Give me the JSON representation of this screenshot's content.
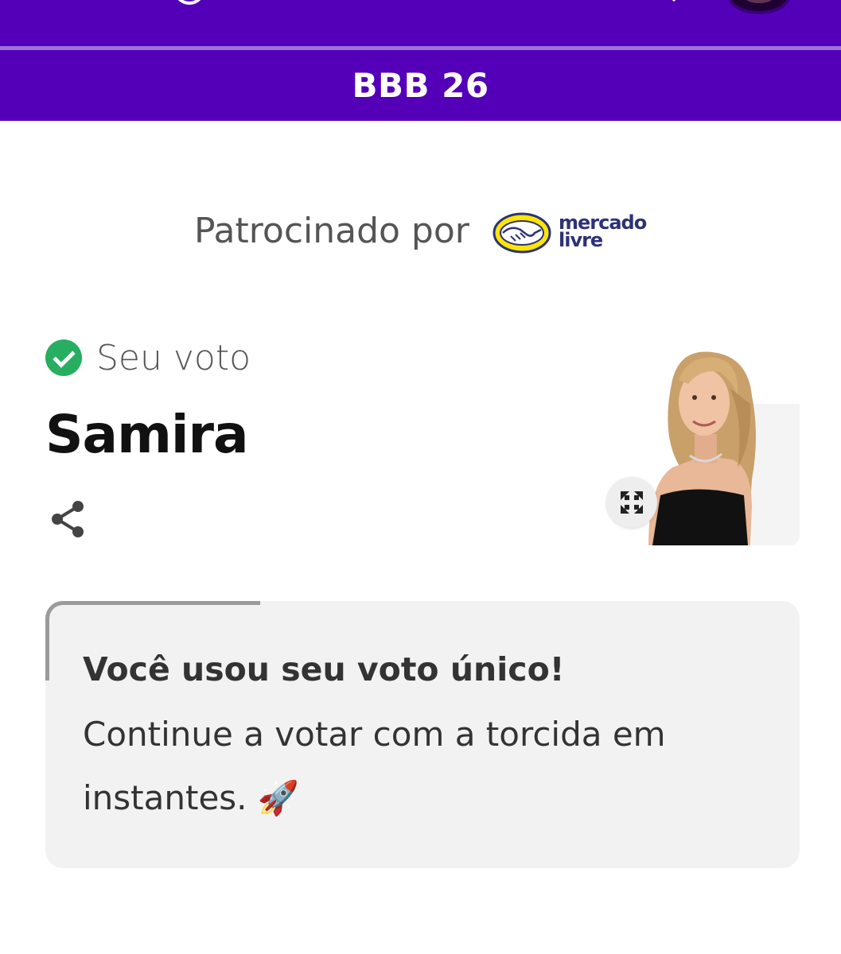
{
  "header": {
    "section_title": "BBB 26"
  },
  "sponsor": {
    "label": "Patrocinado por",
    "logo_line1": "mercado",
    "logo_line2": "livre",
    "logo_colors": {
      "yellow": "#ffe600",
      "navy": "#2d3277"
    }
  },
  "vote": {
    "label": "Seu voto",
    "candidate_name": "Samira"
  },
  "card": {
    "title": "Você usou seu voto único!",
    "body": "Continue a votar com a torcida em instantes. 🚀"
  },
  "colors": {
    "brand_purple": "#5400b8",
    "check_green": "#27ae60",
    "card_bg": "#f2f2f2"
  },
  "icons": [
    "check-circle-icon",
    "share-icon",
    "expand-icon",
    "mercado-livre-logo"
  ]
}
